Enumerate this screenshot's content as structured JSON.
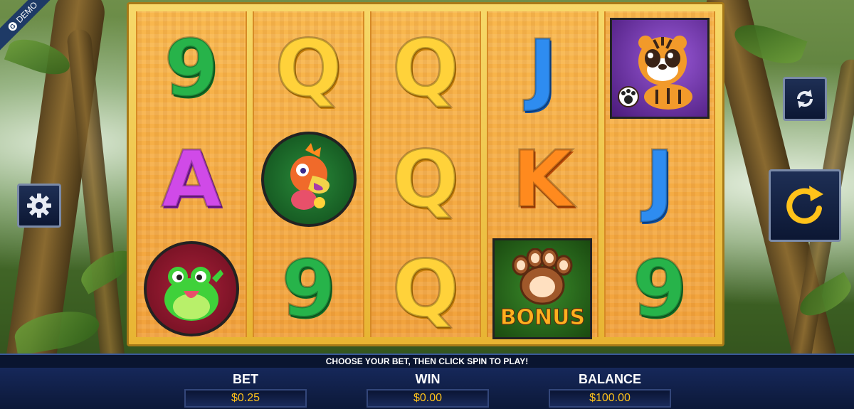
{
  "badge": {
    "label": "DEMO",
    "logo_letter": "G"
  },
  "reels": [
    [
      {
        "symbol": "9",
        "style": "green"
      },
      {
        "symbol": "A",
        "style": "purple"
      },
      {
        "symbol": "frog",
        "style": "medallion"
      }
    ],
    [
      {
        "symbol": "Q",
        "style": "gold"
      },
      {
        "symbol": "bird",
        "style": "medallion"
      },
      {
        "symbol": "9",
        "style": "green"
      }
    ],
    [
      {
        "symbol": "Q",
        "style": "gold"
      },
      {
        "symbol": "Q",
        "style": "gold"
      },
      {
        "symbol": "Q",
        "style": "gold"
      }
    ],
    [
      {
        "symbol": "J",
        "style": "blue"
      },
      {
        "symbol": "K",
        "style": "orange"
      },
      {
        "symbol": "bonus",
        "style": "tile",
        "text": "BONUS"
      }
    ],
    [
      {
        "symbol": "tiger",
        "style": "tile"
      },
      {
        "symbol": "J",
        "style": "blue"
      },
      {
        "symbol": "9",
        "style": "green"
      }
    ]
  ],
  "controls": {
    "settings_icon": "gear-icon",
    "autoplay_icon": "refresh-arrows-icon",
    "spin_icon": "spin-arrow-icon"
  },
  "message": "CHOOSE YOUR BET, THEN CLICK SPIN TO PLAY!",
  "stats": {
    "bet": {
      "label": "BET",
      "value": "$0.25"
    },
    "win": {
      "label": "WIN",
      "value": "$0.00"
    },
    "balance": {
      "label": "BALANCE",
      "value": "$100.00"
    }
  },
  "colors": {
    "accent": "#ffc21a",
    "panel": "#0c1838",
    "reel": "#f2a23c"
  }
}
